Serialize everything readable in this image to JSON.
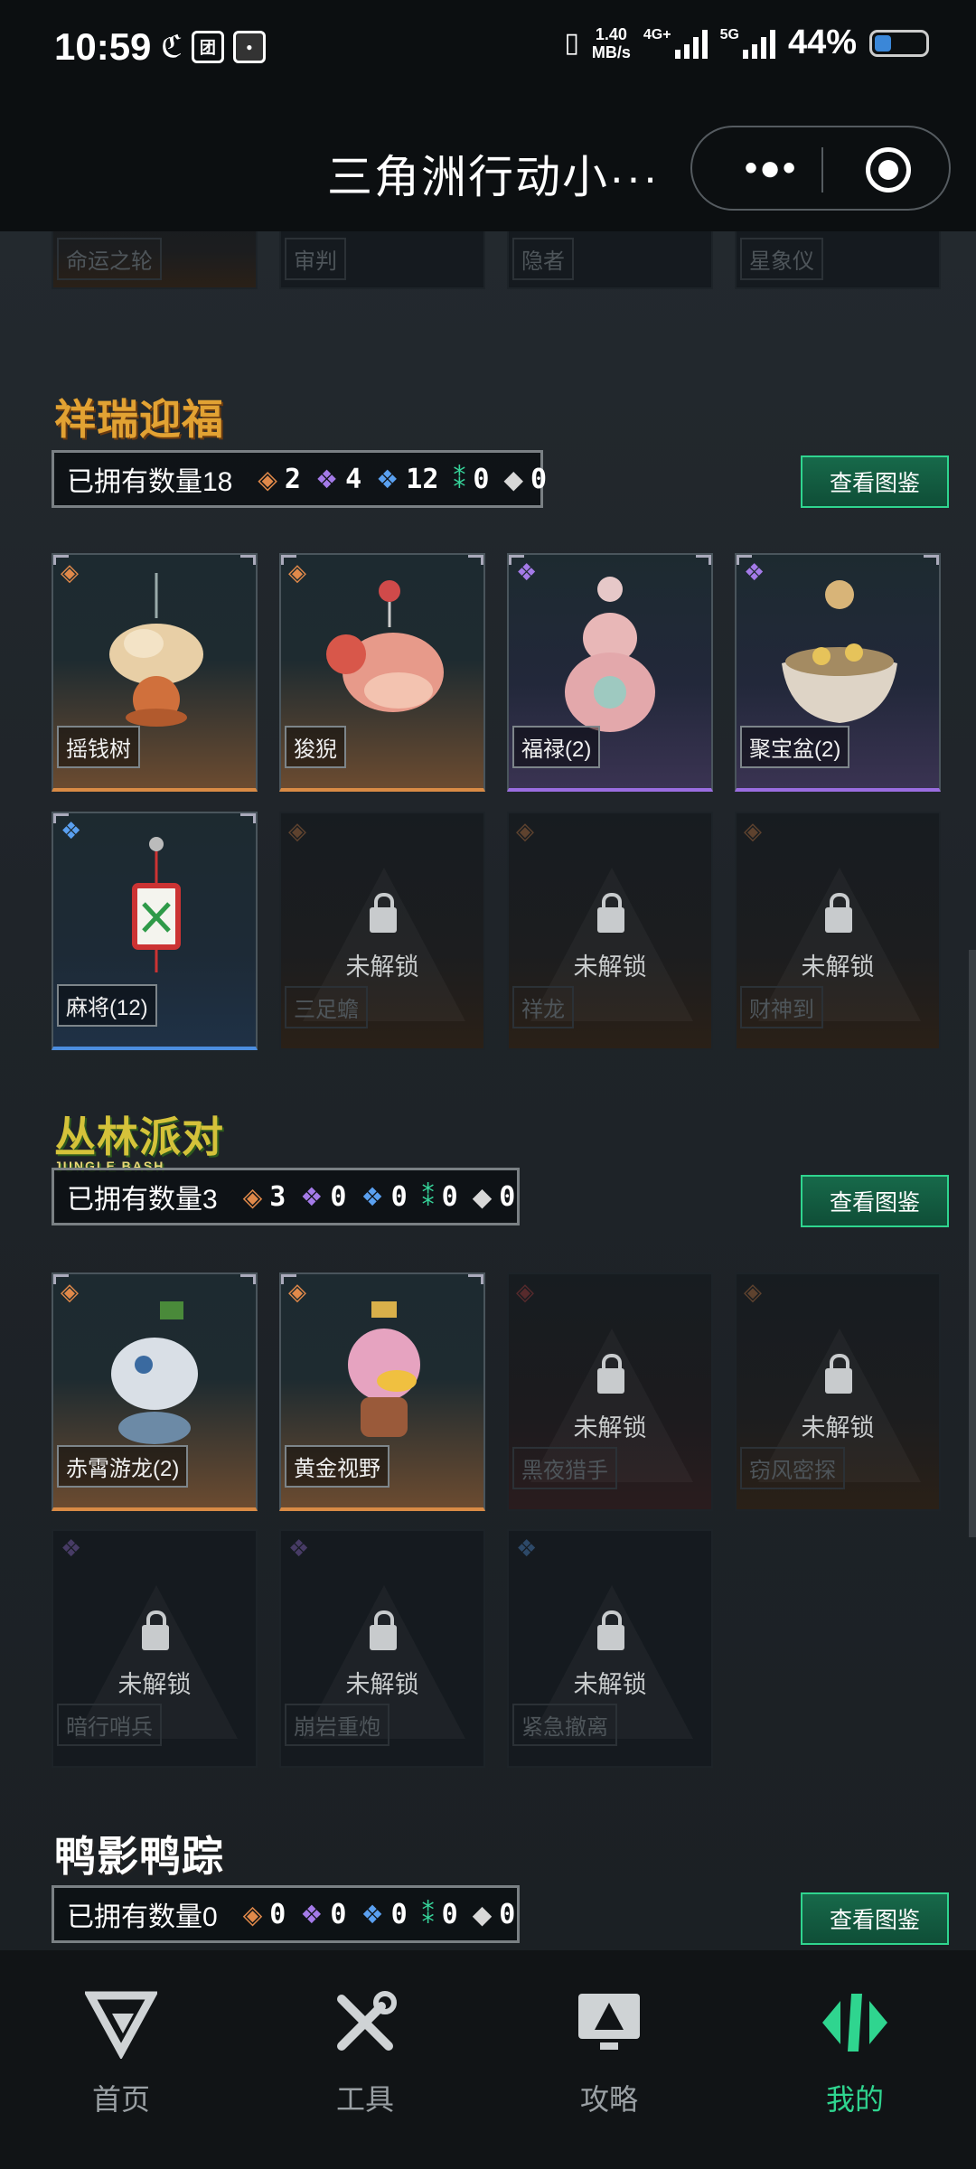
{
  "status_bar": {
    "time": "10:59",
    "net_speed": "1.40",
    "net_unit": "MB/s",
    "net_type_1": "4G+",
    "net_type_2": "5G",
    "battery": "44%"
  },
  "title_bar": {
    "title": "三角洲行动小···"
  },
  "top_row": {
    "locked_label": "未解锁",
    "items": [
      "命运之轮",
      "审判",
      "隐者",
      "星象仪"
    ]
  },
  "sections": [
    {
      "logo": "祥瑞迎福",
      "count_label": "已拥有数量18",
      "counts": [
        "2",
        "4",
        "12",
        "0",
        "0"
      ],
      "view_button": "查看图鉴",
      "items": [
        {
          "name": "摇钱树",
          "locked": false
        },
        {
          "name": "狻猊",
          "locked": false
        },
        {
          "name": "福禄(2)",
          "locked": false
        },
        {
          "name": "聚宝盆(2)",
          "locked": false
        },
        {
          "name": "麻将(12)",
          "locked": false
        },
        {
          "name": "三足蟾",
          "locked": true
        },
        {
          "name": "祥龙",
          "locked": true
        },
        {
          "name": "财神到",
          "locked": true
        }
      ]
    },
    {
      "logo": "丛林派对",
      "logo_sub": "JUNGLE BASH",
      "count_label": "已拥有数量3",
      "counts": [
        "3",
        "0",
        "0",
        "0",
        "0"
      ],
      "view_button": "查看图鉴",
      "items": [
        {
          "name": "赤霄游龙(2)",
          "locked": false
        },
        {
          "name": "黄金视野",
          "locked": false
        },
        {
          "name": "黑夜猎手",
          "locked": true
        },
        {
          "name": "窃风密探",
          "locked": true
        },
        {
          "name": "暗行哨兵",
          "locked": true
        },
        {
          "name": "崩岩重炮",
          "locked": true
        },
        {
          "name": "紧急撤离",
          "locked": true
        }
      ]
    },
    {
      "logo": "鸭影鸭踪",
      "count_label": "已拥有数量0",
      "counts": [
        "0",
        "0",
        "0",
        "0",
        "0"
      ],
      "view_button": "查看图鉴"
    }
  ],
  "bottom_nav": [
    {
      "label": "首页",
      "icon": "home-logo-icon",
      "active": false
    },
    {
      "label": "工具",
      "icon": "tools-icon",
      "active": false
    },
    {
      "label": "攻略",
      "icon": "guide-monitor-icon",
      "active": false
    },
    {
      "label": "我的",
      "icon": "profile-logo-icon",
      "active": true
    }
  ],
  "colors": {
    "accent": "#2fd58f",
    "orange_rarity": "#e0894a",
    "purple_rarity": "#a47ae8",
    "blue_rarity": "#5aa0f0",
    "green_rarity": "#36d49a"
  }
}
